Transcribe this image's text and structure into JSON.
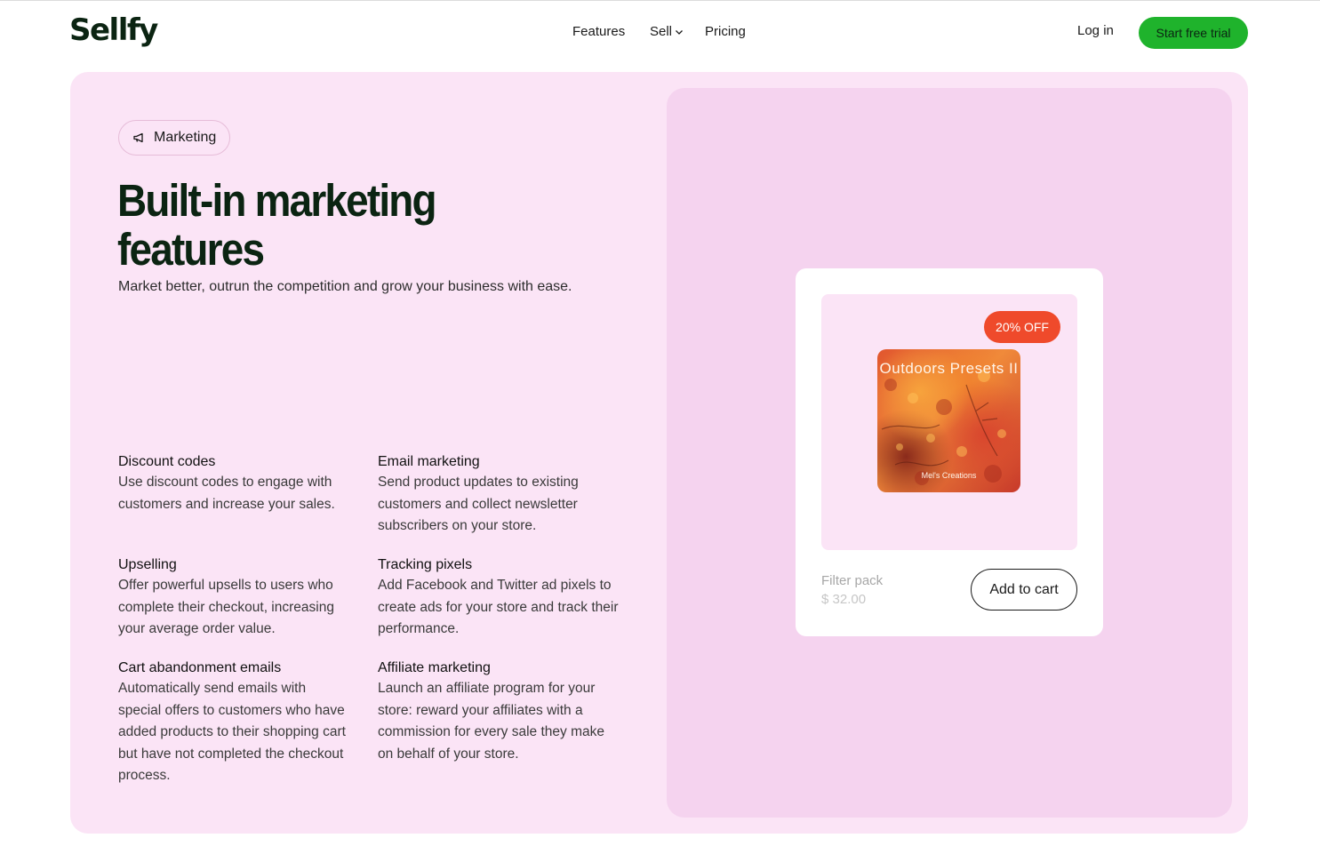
{
  "header": {
    "logo": "Sellfy",
    "nav": {
      "features": "Features",
      "sell": "Sell",
      "pricing": "Pricing"
    },
    "login": "Log in",
    "cta": "Start free trial"
  },
  "hero": {
    "tag": "Marketing",
    "title": "Built-in marketing features",
    "subtitle": "Market better, outrun the competition and grow your business with ease."
  },
  "features": [
    {
      "title": "Discount codes",
      "text": "Use discount codes to engage with customers and increase your sales."
    },
    {
      "title": "Email marketing",
      "text": "Send product updates to existing customers and collect newsletter subscribers on your store."
    },
    {
      "title": "Upselling",
      "text": "Offer powerful upsells to users who complete their checkout, increasing your average order value."
    },
    {
      "title": "Tracking pixels",
      "text": "Add Facebook and Twitter ad pixels to create ads for your store and track their performance."
    },
    {
      "title": "Cart abandonment emails",
      "text": "Automatically send emails with special offers to customers who have added products to their shopping cart but have not completed the checkout process."
    },
    {
      "title": "Affiliate marketing",
      "text": "Launch an affiliate program for your store: reward your affiliates with a commission for every sale they make on behalf of your store."
    }
  ],
  "product": {
    "badge": "20% OFF",
    "image_title": "Outdoors Presets II",
    "image_credit": "Mel's Creations",
    "name": "Filter pack",
    "price": "$ 32.00",
    "button": "Add to cart"
  },
  "colors": {
    "brand_green": "#1fb32c",
    "panel_bg": "#fbe4f6",
    "preview_bg": "#f5d3ef",
    "badge_red": "#ef4a2b",
    "dark_text": "#0b2412"
  },
  "icons": {
    "tag_icon": "megaphone-icon",
    "sell_chevron": "chevron-down-icon"
  }
}
